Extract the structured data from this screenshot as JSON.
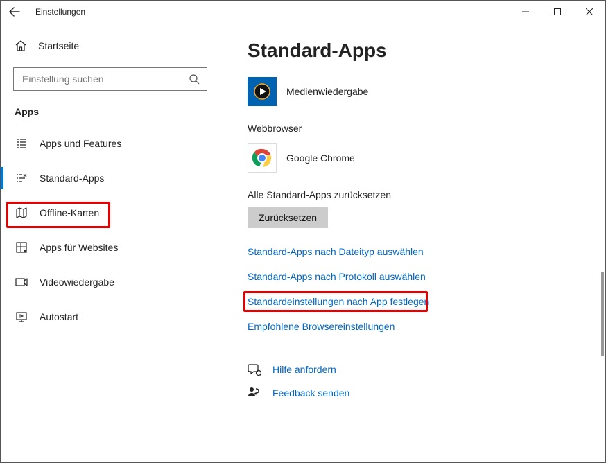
{
  "titlebar": {
    "title": "Einstellungen"
  },
  "sidebar": {
    "home": "Startseite",
    "search_placeholder": "Einstellung suchen",
    "section": "Apps",
    "items": [
      {
        "label": "Apps und Features"
      },
      {
        "label": "Standard-Apps"
      },
      {
        "label": "Offline-Karten"
      },
      {
        "label": "Apps für Websites"
      },
      {
        "label": "Videowiedergabe"
      },
      {
        "label": "Autostart"
      }
    ]
  },
  "content": {
    "title": "Standard-Apps",
    "media_player": {
      "label": "Medienwiedergabe"
    },
    "browser_hdr": "Webbrowser",
    "browser": {
      "label": "Google Chrome"
    },
    "reset_hdr": "Alle Standard-Apps zurücksetzen",
    "reset_btn": "Zurücksetzen",
    "links": [
      "Standard-Apps nach Dateityp auswählen",
      "Standard-Apps nach Protokoll auswählen",
      "Standardeinstellungen nach App festlegen",
      "Empfohlene Browsereinstellungen"
    ],
    "help": {
      "get_help": "Hilfe anfordern",
      "feedback": "Feedback senden"
    }
  }
}
